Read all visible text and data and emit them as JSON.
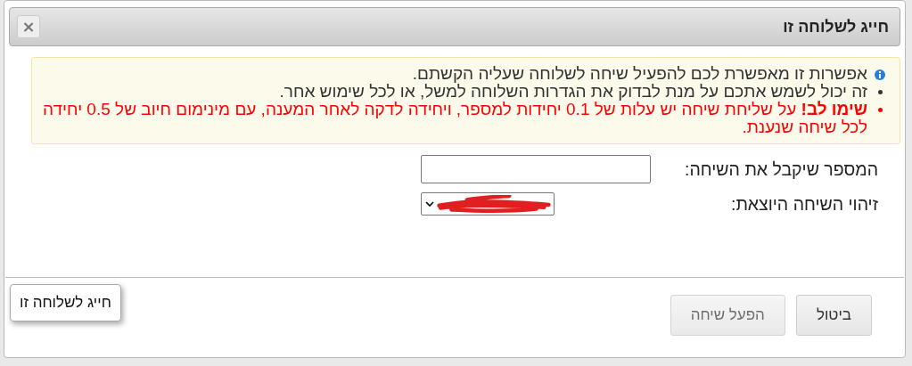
{
  "dialog": {
    "title": "חייג לשלוחה זו",
    "close_button": "×"
  },
  "notice": {
    "items": [
      {
        "kind": "info",
        "text": "אפשרות זו מאפשרת לכם להפעיל שיחה לשלוחה שעליה הקשתם."
      },
      {
        "kind": "plain",
        "text": "זה יכול לשמש אתכם על מנת לבדוק את הגדרות השלוחה למשל, או לכל שימוש אחר."
      },
      {
        "kind": "warning",
        "text": "**שימו לב!** על שליחת שיחה יש עלות של 0.1 יחידות למספר, ויחידה לדקה לאחר המענה, עם מינימום חיוב של 0.5 יחידה לכל שיחה שנענת."
      }
    ]
  },
  "form": {
    "fields": [
      {
        "kind": "input",
        "label": "המספר שיקבל את השיחה:"
      },
      {
        "kind": "select",
        "label": "זיהוי השיחה היוצאת:",
        "redacted": true
      }
    ]
  },
  "buttons": [
    {
      "label": "ביטול",
      "disabled": false
    },
    {
      "label": "הפעל שיחה",
      "disabled": true
    }
  ],
  "tooltip": "חייג לשלוחה זו"
}
